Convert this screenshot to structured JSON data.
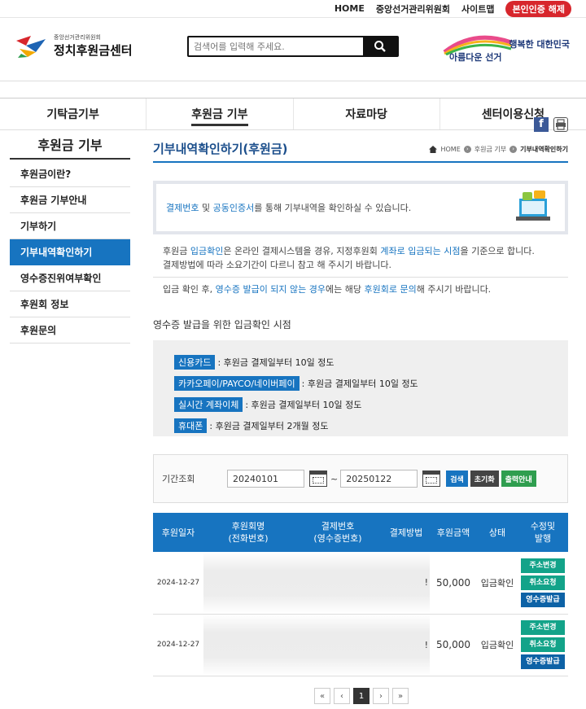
{
  "topbar": {
    "links": [
      "HOME",
      "중앙선거관리위원회",
      "사이트맵"
    ],
    "cert_label": "본인인증 해제"
  },
  "header": {
    "logo_small": "중앙선거관리위원회",
    "logo_big": "정치후원금센터",
    "search_placeholder": "검색어를 입력해 주세요.",
    "banner_line1": "행복한 대한민국",
    "banner_line2": "아름다운 선거"
  },
  "gnb": [
    "기탁금기부",
    "후원금 기부",
    "자료마당",
    "센터이용신청"
  ],
  "lnb": {
    "title": "후원금 기부",
    "items": [
      "후원금이란?",
      "후원금 기부안내",
      "기부하기",
      "기부내역확인하기",
      "영수증진위여부확인",
      "후원회 정보",
      "후원문의"
    ],
    "active_index": 3
  },
  "page": {
    "title": "기부내역확인하기(후원금)",
    "breadcrumb": [
      "HOME",
      "후원금 기부",
      "기부내역확인하기"
    ]
  },
  "info": {
    "hl1": "결제번호",
    "mid1": " 및 ",
    "hl2": "공동인증서",
    "rest": "를 통해 기부내역을 확인하실 수 있습니다."
  },
  "notice": {
    "p1_a": "후원금 ",
    "p1_hl1": "입금확인",
    "p1_b": "은 온라인 결제시스템을 경유, 지정후원회 ",
    "p1_hl2": "계좌로 입금되는 시점",
    "p1_c": "을 기준으로 합니다.",
    "p1_line2": "결제방법에 따라 소요기간이 다르니 참고 해 주시기 바랍니다.",
    "p2_a": "입금 확인 후, ",
    "p2_hl1": "영수증 발급이 되지 않는 경우",
    "p2_b": "에는 해당 ",
    "p2_hl2": "후원회로 문의",
    "p2_c": "해 주시기 바랍니다."
  },
  "timing": {
    "heading": "영수증 발급을 위한 입금확인 시점",
    "rows": [
      {
        "tag": "신용카드",
        "text": ": 후원금 결제일부터 10일 정도"
      },
      {
        "tag": "카카오페이/PAYCO/네이버페이",
        "text": ": 후원금 결제일부터 10일 정도"
      },
      {
        "tag": "실시간 계좌이체",
        "text": ": 후원금 결제일부터 10일 정도"
      },
      {
        "tag": "휴대폰",
        "text": ": 후원금 결제일부터 2개월 정도"
      }
    ]
  },
  "query": {
    "label": "기간조회",
    "from": "20240101",
    "to": "20250122",
    "tilde": "~",
    "btn_search": "검색",
    "btn_reset": "초기화",
    "btn_print": "출력안내"
  },
  "table": {
    "headers": [
      "후원일자",
      "후원회명\n(전화번호)",
      "결제번호\n(영수증번호)",
      "결제방법",
      "후원금액",
      "상태",
      "수정및\n발행"
    ],
    "rows": [
      {
        "date": "2024-12-27",
        "method": "!",
        "amount": "50,000",
        "status": "입금확인",
        "actions": [
          "주소변경",
          "취소요청",
          "영수증발급"
        ]
      },
      {
        "date": "2024-12-27",
        "method": "!",
        "amount": "50,000",
        "status": "입금확인",
        "actions": [
          "주소변경",
          "취소요청",
          "영수증발급"
        ]
      }
    ]
  },
  "pager": {
    "first": "«",
    "prev": "‹",
    "current": "1",
    "next": "›",
    "last": "»"
  },
  "colors": {
    "primary": "#1774c0",
    "teal": "#13a389",
    "navy": "#0d62a6",
    "cert_red": "#d7262c"
  }
}
